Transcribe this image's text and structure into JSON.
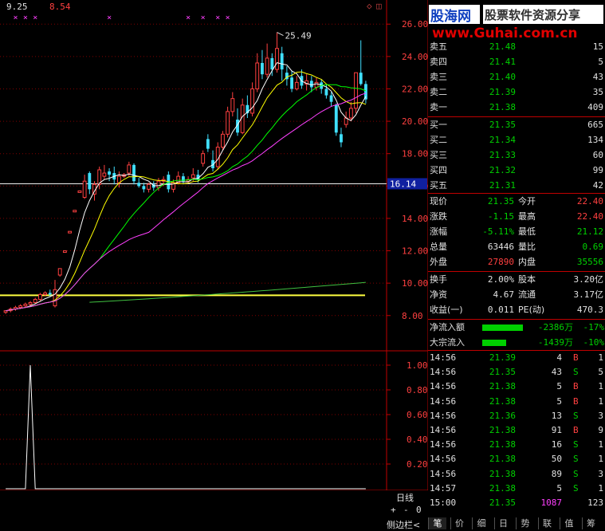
{
  "header": {
    "val_a": "9.25",
    "val_b": "8.54",
    "icons": [
      "diamond-icon",
      "square-icon"
    ]
  },
  "watermark": {
    "logo": "股海网",
    "slogan": "股票软件资源分享",
    "url": "www.Guhai.com.cn"
  },
  "price_axis": {
    "labels": [
      "26.00",
      "24.00",
      "22.00",
      "20.00",
      "18.00",
      "16.00",
      "14.00",
      "12.00",
      "10.00",
      "8.00"
    ],
    "highlight": "16.14"
  },
  "chart_data": {
    "type": "candlestick",
    "max_label": "25.49",
    "horizontal_lines": [
      16.14,
      9.25
    ],
    "x_ticks": [
      "3",
      "4",
      "5"
    ],
    "candles": [
      {
        "o": 8.2,
        "c": 8.3,
        "h": 8.3,
        "l": 8.1
      },
      {
        "o": 8.3,
        "c": 8.4,
        "h": 8.5,
        "l": 8.2
      },
      {
        "o": 8.4,
        "c": 8.5,
        "h": 8.6,
        "l": 8.3
      },
      {
        "o": 8.5,
        "c": 8.6,
        "h": 8.7,
        "l": 8.4
      },
      {
        "o": 8.6,
        "c": 8.7,
        "h": 8.8,
        "l": 8.5
      },
      {
        "o": 8.7,
        "c": 8.8,
        "h": 8.9,
        "l": 8.6
      },
      {
        "o": 8.8,
        "c": 9.0,
        "h": 9.1,
        "l": 8.7
      },
      {
        "o": 9.0,
        "c": 9.3,
        "h": 9.4,
        "l": 8.9
      },
      {
        "o": 9.3,
        "c": 9.4,
        "h": 9.5,
        "l": 9.2
      },
      {
        "o": 9.4,
        "c": 9.3,
        "h": 9.6,
        "l": 9.2
      },
      {
        "o": 8.6,
        "c": 9.6,
        "h": 10.2,
        "l": 8.5
      },
      {
        "o": 10.5,
        "c": 10.9,
        "h": 10.9,
        "l": 10.4
      },
      {
        "o": 11.9,
        "c": 12.0,
        "h": 12.0,
        "l": 11.9
      },
      {
        "o": 13.1,
        "c": 13.2,
        "h": 13.2,
        "l": 13.1
      },
      {
        "o": 14.4,
        "c": 14.5,
        "h": 14.5,
        "l": 14.4
      },
      {
        "o": 15.6,
        "c": 15.7,
        "h": 15.7,
        "l": 15.6
      },
      {
        "o": 15.3,
        "c": 16.3,
        "h": 16.7,
        "l": 15.2
      },
      {
        "o": 16.8,
        "c": 15.8,
        "h": 16.9,
        "l": 15.5
      },
      {
        "o": 15.5,
        "c": 16.1,
        "h": 16.3,
        "l": 15.1
      },
      {
        "o": 16.1,
        "c": 17.0,
        "h": 17.2,
        "l": 15.8
      },
      {
        "o": 16.6,
        "c": 16.8,
        "h": 17.3,
        "l": 16.4
      },
      {
        "o": 16.9,
        "c": 16.7,
        "h": 17.1,
        "l": 16.3
      },
      {
        "o": 16.8,
        "c": 16.4,
        "h": 17.2,
        "l": 16.1
      },
      {
        "o": 16.2,
        "c": 16.6,
        "h": 16.9,
        "l": 15.9
      },
      {
        "o": 16.6,
        "c": 16.7,
        "h": 16.8,
        "l": 16.5
      },
      {
        "o": 16.8,
        "c": 17.3,
        "h": 17.5,
        "l": 16.6
      },
      {
        "o": 17.3,
        "c": 16.3,
        "h": 17.4,
        "l": 16.1
      },
      {
        "o": 16.2,
        "c": 16.0,
        "h": 16.5,
        "l": 15.9
      },
      {
        "o": 16.0,
        "c": 15.8,
        "h": 16.2,
        "l": 15.6
      },
      {
        "o": 15.8,
        "c": 16.1,
        "h": 16.2,
        "l": 15.6
      },
      {
        "o": 16.1,
        "c": 15.9,
        "h": 16.3,
        "l": 15.7
      },
      {
        "o": 15.9,
        "c": 16.3,
        "h": 16.5,
        "l": 15.7
      },
      {
        "o": 16.3,
        "c": 16.4,
        "h": 16.6,
        "l": 16.0
      },
      {
        "o": 16.7,
        "c": 15.8,
        "h": 16.9,
        "l": 15.6
      },
      {
        "o": 15.8,
        "c": 16.2,
        "h": 16.4,
        "l": 15.6
      },
      {
        "o": 16.2,
        "c": 16.6,
        "h": 16.9,
        "l": 16.1
      },
      {
        "o": 16.6,
        "c": 16.3,
        "h": 16.8,
        "l": 16.1
      },
      {
        "o": 16.3,
        "c": 16.4,
        "h": 16.6,
        "l": 16.2
      },
      {
        "o": 16.5,
        "c": 16.7,
        "h": 17.1,
        "l": 16.3
      },
      {
        "o": 16.7,
        "c": 16.4,
        "h": 17.0,
        "l": 16.2
      },
      {
        "o": 17.4,
        "c": 18.0,
        "h": 18.2,
        "l": 17.2
      },
      {
        "o": 18.9,
        "c": 18.3,
        "h": 19.2,
        "l": 18.1
      },
      {
        "o": 17.6,
        "c": 17.1,
        "h": 18.2,
        "l": 16.9
      },
      {
        "o": 17.2,
        "c": 18.4,
        "h": 18.7,
        "l": 17.0
      },
      {
        "o": 18.4,
        "c": 19.2,
        "h": 19.4,
        "l": 18.2
      },
      {
        "o": 19.2,
        "c": 20.6,
        "h": 20.9,
        "l": 19.0
      },
      {
        "o": 20.6,
        "c": 21.4,
        "h": 21.8,
        "l": 20.3
      },
      {
        "o": 20.1,
        "c": 19.3,
        "h": 20.8,
        "l": 19.1
      },
      {
        "o": 19.3,
        "c": 21.0,
        "h": 21.4,
        "l": 19.2
      },
      {
        "o": 21.0,
        "c": 20.5,
        "h": 21.6,
        "l": 20.2
      },
      {
        "o": 20.5,
        "c": 22.0,
        "h": 22.4,
        "l": 20.3
      },
      {
        "o": 22.0,
        "c": 23.6,
        "h": 24.2,
        "l": 21.8
      },
      {
        "o": 23.6,
        "c": 22.9,
        "h": 24.4,
        "l": 22.6
      },
      {
        "o": 22.9,
        "c": 23.9,
        "h": 24.8,
        "l": 22.7
      },
      {
        "o": 23.9,
        "c": 23.2,
        "h": 24.2,
        "l": 22.8
      },
      {
        "o": 23.2,
        "c": 24.5,
        "h": 25.49,
        "l": 23.0
      },
      {
        "o": 24.2,
        "c": 23.2,
        "h": 24.6,
        "l": 22.5
      },
      {
        "o": 23.0,
        "c": 22.6,
        "h": 23.4,
        "l": 22.2
      },
      {
        "o": 22.7,
        "c": 22.0,
        "h": 23.1,
        "l": 21.8
      },
      {
        "o": 22.0,
        "c": 22.4,
        "h": 22.8,
        "l": 21.9
      },
      {
        "o": 22.8,
        "c": 22.2,
        "h": 23.2,
        "l": 22.0
      },
      {
        "o": 22.3,
        "c": 22.5,
        "h": 22.9,
        "l": 21.9
      },
      {
        "o": 22.5,
        "c": 22.1,
        "h": 22.8,
        "l": 21.8
      },
      {
        "o": 22.1,
        "c": 22.4,
        "h": 22.7,
        "l": 21.9
      },
      {
        "o": 22.4,
        "c": 22.0,
        "h": 22.6,
        "l": 21.7
      },
      {
        "o": 22.0,
        "c": 21.6,
        "h": 22.3,
        "l": 21.4
      },
      {
        "o": 21.6,
        "c": 21.2,
        "h": 21.8,
        "l": 20.9
      },
      {
        "o": 21.0,
        "c": 19.3,
        "h": 21.1,
        "l": 19.1
      },
      {
        "o": 19.2,
        "c": 18.7,
        "h": 19.6,
        "l": 18.4
      },
      {
        "o": 19.8,
        "c": 20.2,
        "h": 20.6,
        "l": 19.6
      },
      {
        "o": 20.2,
        "c": 20.8,
        "h": 21.2,
        "l": 20.0
      },
      {
        "o": 20.8,
        "c": 23.0,
        "h": 23.0,
        "l": 20.5
      },
      {
        "o": 23.0,
        "c": 22.3,
        "h": 25.0,
        "l": 22.2
      },
      {
        "o": 22.3,
        "c": 21.35,
        "h": 22.5,
        "l": 21.1
      }
    ],
    "markers": [
      2,
      4,
      6,
      21,
      37,
      40,
      43,
      45
    ],
    "indicator": {
      "y_labels": [
        "1.00",
        "0.80",
        "0.60",
        "0.40",
        "0.20"
      ],
      "spike_index": 5
    }
  },
  "order_book": {
    "asks": [
      {
        "label": "卖五",
        "price": "21.48",
        "vol": "15"
      },
      {
        "label": "卖四",
        "price": "21.41",
        "vol": "5"
      },
      {
        "label": "卖三",
        "price": "21.40",
        "vol": "43"
      },
      {
        "label": "卖二",
        "price": "21.39",
        "vol": "35"
      },
      {
        "label": "卖一",
        "price": "21.38",
        "vol": "409"
      }
    ],
    "bids": [
      {
        "label": "买一",
        "price": "21.35",
        "vol": "665"
      },
      {
        "label": "买二",
        "price": "21.34",
        "vol": "134"
      },
      {
        "label": "买三",
        "price": "21.33",
        "vol": "60"
      },
      {
        "label": "买四",
        "price": "21.32",
        "vol": "99"
      },
      {
        "label": "买五",
        "price": "21.31",
        "vol": "42"
      }
    ]
  },
  "quote": [
    {
      "l1": "现价",
      "v1": "21.35",
      "c1": "green",
      "l2": "今开",
      "v2": "22.40",
      "c2": "red"
    },
    {
      "l1": "涨跌",
      "v1": "-1.15",
      "c1": "green",
      "l2": "最高",
      "v2": "22.40",
      "c2": "red"
    },
    {
      "l1": "涨幅",
      "v1": "-5.11%",
      "c1": "green",
      "l2": "最低",
      "v2": "21.12",
      "c2": "green"
    },
    {
      "l1": "总量",
      "v1": "63446",
      "c1": "white",
      "l2": "量比",
      "v2": "0.69",
      "c2": "green"
    },
    {
      "l1": "外盘",
      "v1": "27890",
      "c1": "red",
      "l2": "内盘",
      "v2": "35556",
      "c2": "green"
    }
  ],
  "quote2": [
    {
      "l1": "换手",
      "v1": "2.00%",
      "l2": "股本",
      "v2": "3.20亿"
    },
    {
      "l1": "净资",
      "v1": "4.67",
      "l2": "流通",
      "v2": "3.17亿"
    },
    {
      "l1": "收益(一)",
      "v1": "0.011",
      "l2": "PE(动)",
      "v2": "470.3"
    }
  ],
  "flows": [
    {
      "label": "净流入额",
      "amount": "-2386万",
      "pct": "-17%",
      "bar": 0.17
    },
    {
      "label": "大宗流入",
      "amount": "-1439万",
      "pct": "-10%",
      "bar": 0.1
    }
  ],
  "trades": [
    {
      "t": "14:56",
      "p": "21.39",
      "v": "4",
      "d": "B",
      "n": "1"
    },
    {
      "t": "14:56",
      "p": "21.35",
      "v": "43",
      "d": "S",
      "n": "5"
    },
    {
      "t": "14:56",
      "p": "21.38",
      "v": "5",
      "d": "B",
      "n": "1"
    },
    {
      "t": "14:56",
      "p": "21.38",
      "v": "5",
      "d": "B",
      "n": "1"
    },
    {
      "t": "14:56",
      "p": "21.36",
      "v": "13",
      "d": "S",
      "n": "3"
    },
    {
      "t": "14:56",
      "p": "21.38",
      "v": "91",
      "d": "B",
      "n": "9"
    },
    {
      "t": "14:56",
      "p": "21.38",
      "v": "16",
      "d": "S",
      "n": "1"
    },
    {
      "t": "14:56",
      "p": "21.38",
      "v": "50",
      "d": "S",
      "n": "1"
    },
    {
      "t": "14:56",
      "p": "21.38",
      "v": "89",
      "d": "S",
      "n": "3"
    },
    {
      "t": "14:57",
      "p": "21.38",
      "v": "5",
      "d": "S",
      "n": "1"
    },
    {
      "t": "15:00",
      "p": "21.35",
      "v": "1087",
      "d": "",
      "n": "123"
    }
  ],
  "period": {
    "label": "日线",
    "plus": "+",
    "minus": "-",
    "zero": "0"
  },
  "side_button": "侧边栏<",
  "tabs": [
    "笔",
    "价",
    "细",
    "日",
    "势",
    "联",
    "值",
    "筹"
  ],
  "colors": {
    "up": "#ff4040",
    "down": "#40e0ff",
    "ma1": "#ffffff",
    "ma2": "#ffff00",
    "ma3": "#00ff00",
    "ma4": "#ff40ff",
    "bg": "#000000",
    "frame": "#c00000"
  }
}
